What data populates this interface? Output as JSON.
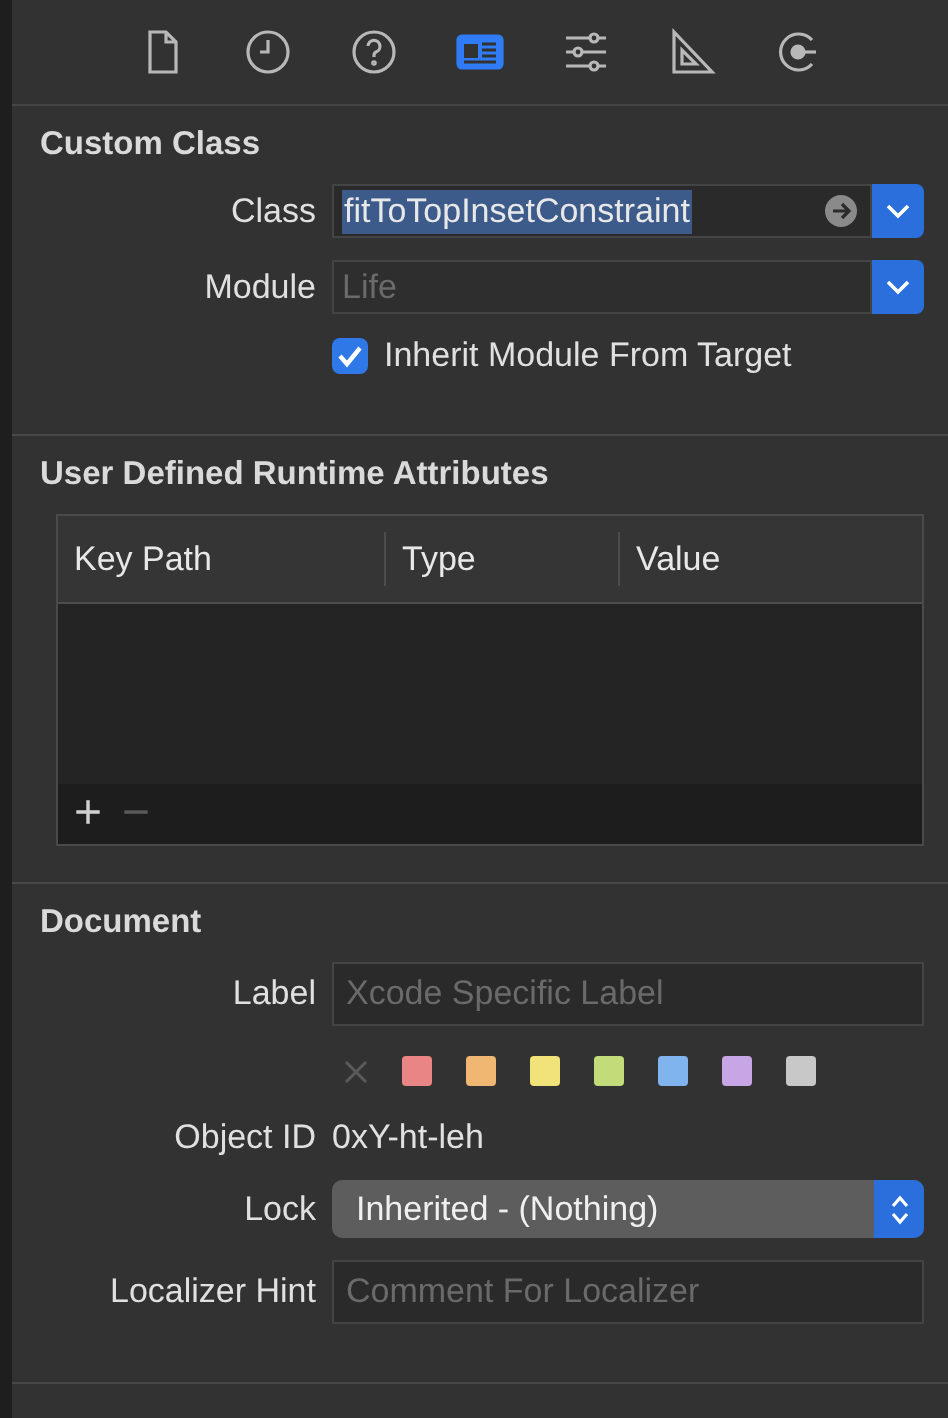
{
  "toolbar": {
    "tabs": [
      {
        "selected": false
      },
      {
        "selected": false
      },
      {
        "selected": false
      },
      {
        "selected": true
      },
      {
        "selected": false
      },
      {
        "selected": false
      },
      {
        "selected": false
      }
    ]
  },
  "custom_class": {
    "title": "Custom Class",
    "class": {
      "label": "Class",
      "value": "fitToTopInsetConstraint",
      "selected": true
    },
    "module": {
      "label": "Module",
      "placeholder": "Life",
      "disabled": true
    },
    "inherit": {
      "label": "Inherit Module From Target",
      "checked": true
    }
  },
  "runtime_attributes": {
    "title": "User Defined Runtime Attributes",
    "columns": [
      "Key Path",
      "Type",
      "Value"
    ],
    "add": "+",
    "remove": "−"
  },
  "document": {
    "title": "Document",
    "label": {
      "label": "Label",
      "placeholder": "Xcode Specific Label"
    },
    "swatches": [
      {
        "color": "#e98585",
        "selected": false
      },
      {
        "color": "#f0b772",
        "selected": false
      },
      {
        "color": "#f1e27a",
        "selected": false
      },
      {
        "color": "#c2dc7a",
        "selected": false
      },
      {
        "color": "#7fb4ef",
        "selected": false
      },
      {
        "color": "#c8a6e6",
        "selected": false
      },
      {
        "color": "#c8c8c8",
        "selected": false
      }
    ],
    "object_id": {
      "label": "Object ID",
      "value": "0xY-ht-leh"
    },
    "lock": {
      "label": "Lock",
      "value": "Inherited - (Nothing)"
    },
    "localizer_hint": {
      "label": "Localizer Hint",
      "placeholder": "Comment For Localizer"
    }
  }
}
